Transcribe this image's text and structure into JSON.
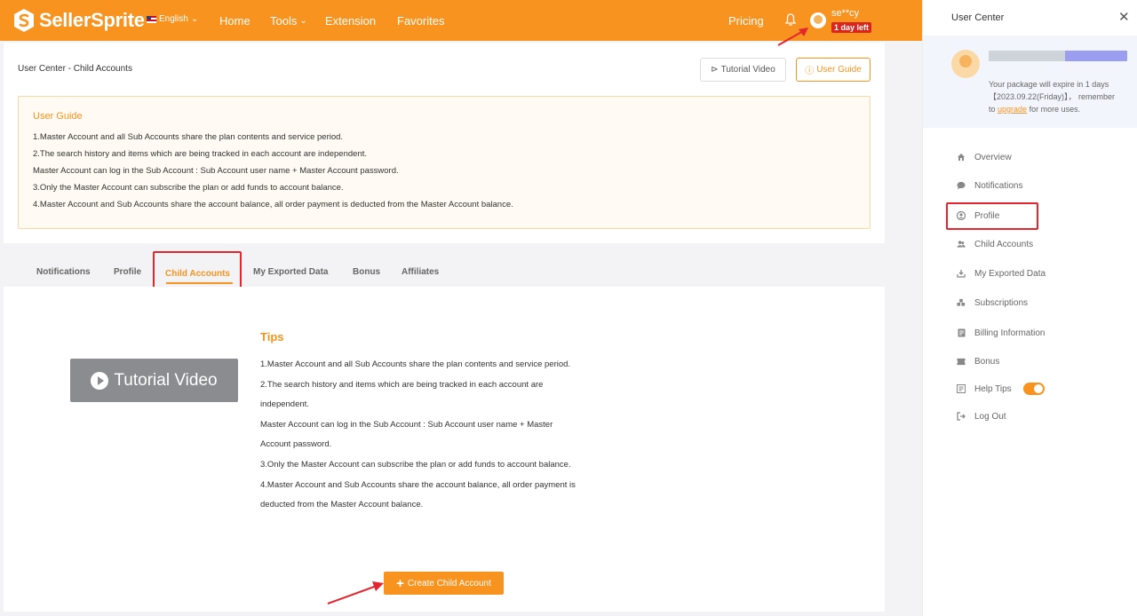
{
  "topbar": {
    "brand": "SellerSprite",
    "language": "English",
    "nav": {
      "home": "Home",
      "tools": "Tools",
      "extension": "Extension",
      "favorites": "Favorites",
      "pricing": "Pricing"
    },
    "user_name": "se**cy",
    "days_left": "1 day left"
  },
  "header": {
    "breadcrumb": "User Center - Child Accounts",
    "tutorial_video": "Tutorial Video",
    "user_guide": "User Guide"
  },
  "guide": {
    "title": "User Guide",
    "lines": [
      "1.Master Account and all Sub Accounts share the plan contents and service period.",
      "2.The search history and items which are being tracked in each account are independent.",
      "Master Account can log in the Sub Account : Sub Account user name + Master Account password.",
      "3.Only the Master Account can subscribe the plan or add funds to account balance.",
      "4.Master Account and Sub Accounts share the account balance, all order payment is deducted from the Master Account balance."
    ]
  },
  "tabs": [
    "Notifications",
    "Profile",
    "Child Accounts",
    "My Exported Data",
    "Bonus",
    "Affiliates"
  ],
  "content": {
    "video_label": "Tutorial Video",
    "tips_title": "Tips",
    "tips": [
      "1.Master Account and all Sub Accounts share the plan contents and service period.",
      "2.The search history and items which are being tracked in each account are",
      "independent.",
      "Master Account can log in the Sub Account : Sub Account user name + Master",
      "Account password.",
      "3.Only the Master Account can subscribe the plan or add funds to account balance.",
      "4.Master Account and Sub Accounts share the account balance, all order payment is",
      "deducted from the Master Account balance."
    ],
    "create_button": "Create Child Account"
  },
  "panel": {
    "title": "User Center",
    "expire_text_1": "Your package will expire in 1 days",
    "expire_text_2": "【2023.09.22(Friday)】， remember",
    "expire_text_3_prefix": "to",
    "upgrade": "upgrade",
    "expire_text_3_suffix": "for more uses.",
    "menu": [
      {
        "label": "Overview",
        "icon": "home-icon"
      },
      {
        "label": "Notifications",
        "icon": "chat-icon"
      },
      {
        "label": "Profile",
        "icon": "user-circle-icon"
      },
      {
        "label": "Child Accounts",
        "icon": "users-icon"
      },
      {
        "label": "My Exported Data",
        "icon": "download-icon"
      },
      {
        "label": "Subscriptions",
        "icon": "cubes-icon"
      },
      {
        "label": "Billing Information",
        "icon": "bill-icon"
      },
      {
        "label": "Bonus",
        "icon": "ticket-icon"
      },
      {
        "label": "Help Tips",
        "icon": "doc-icon"
      },
      {
        "label": "Log Out",
        "icon": "logout-icon"
      }
    ],
    "help_tips_enabled": true
  },
  "colors": {
    "brand": "#f7931e",
    "highlight": "#e3262e",
    "badge": "#d9251c"
  }
}
